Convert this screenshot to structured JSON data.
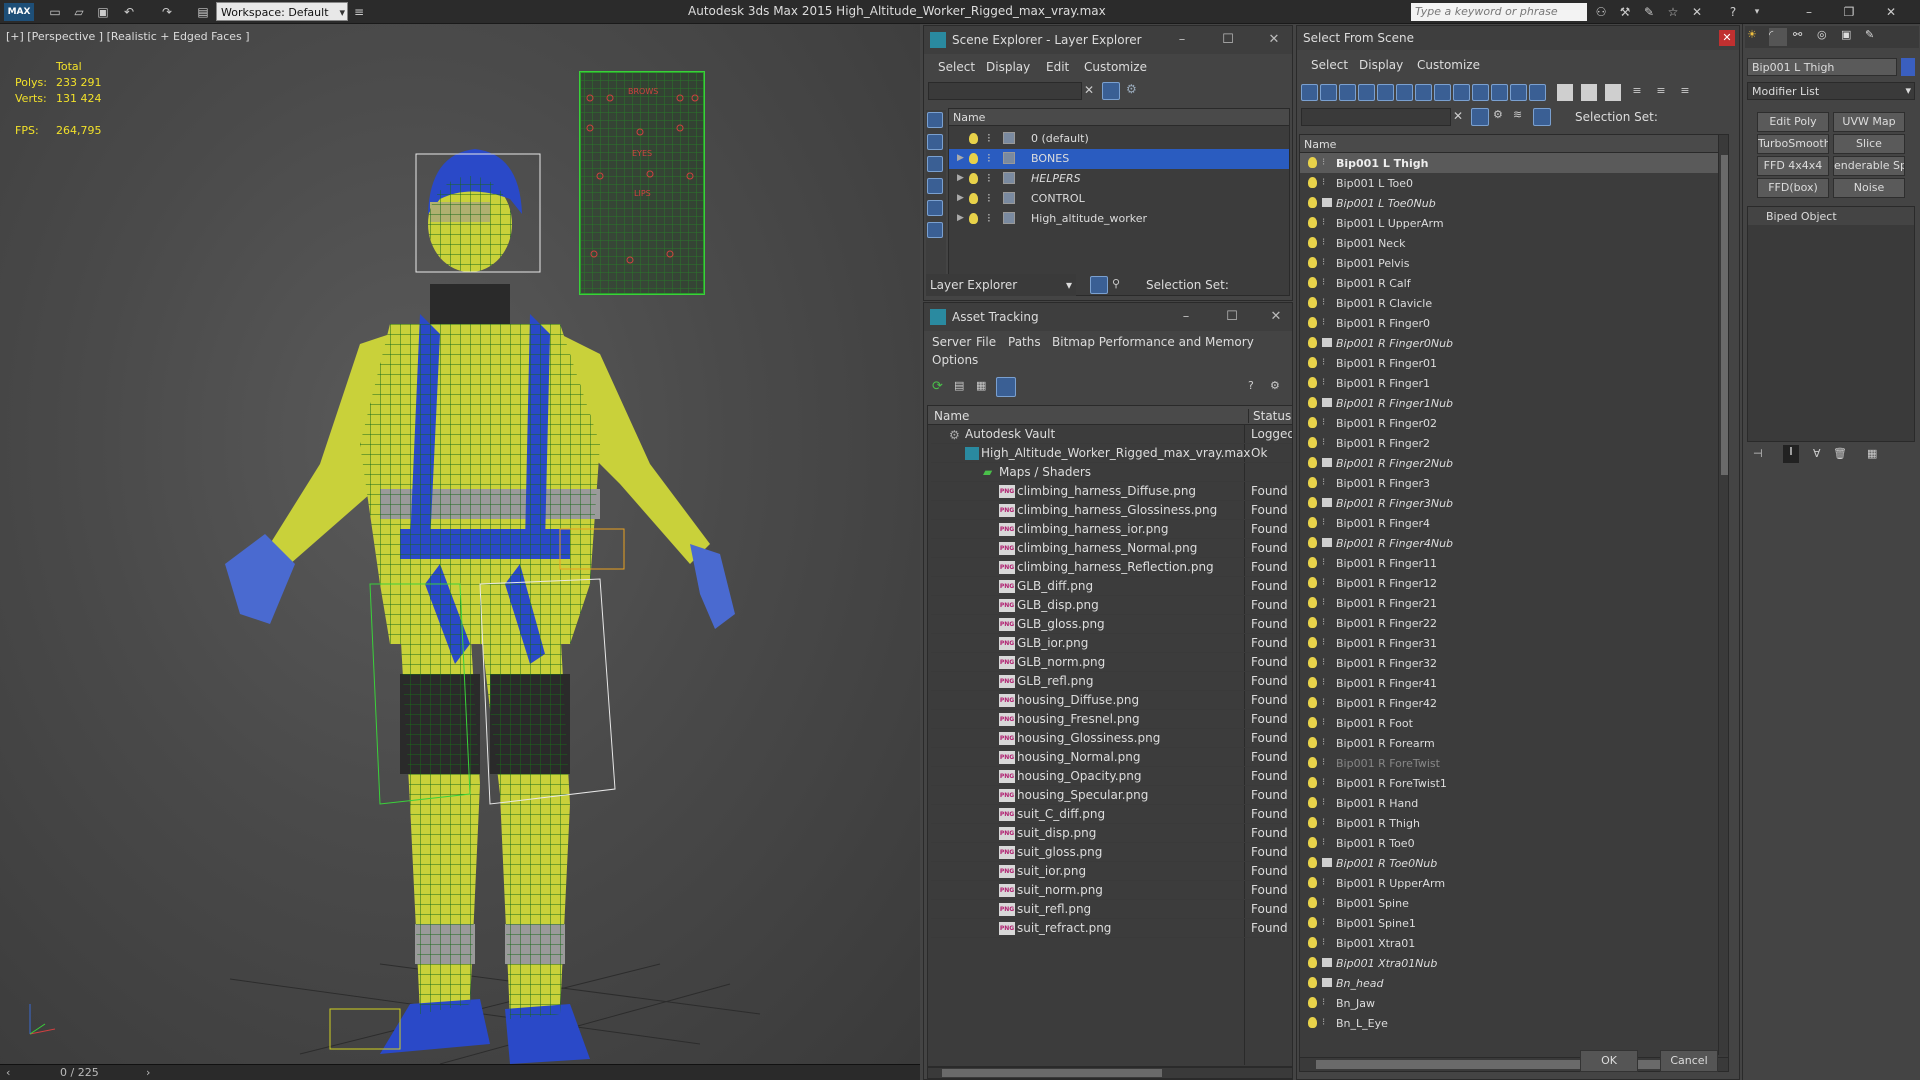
{
  "app": {
    "title": "Autodesk 3ds Max  2015     High_Altitude_Worker_Rigged_max_vray.max",
    "workspace": "Workspace: Default",
    "search_placeholder": "Type a keyword or phrase"
  },
  "viewport": {
    "label": "[+] [Perspective ] [Realistic + Edged Faces ]",
    "total_label": "Total",
    "polys_label": "Polys:",
    "polys_value": "233 291",
    "verts_label": "Verts:",
    "verts_value": "131 424",
    "fps_label": "FPS:",
    "fps_value": "264,795",
    "timeline": "0 / 225",
    "panel_labels": {
      "brows": "BROWS",
      "eyes": "EYES",
      "lips": "LIPS"
    }
  },
  "scene_explorer": {
    "title": "Scene Explorer - Layer Explorer",
    "menu": [
      "Select",
      "Display",
      "Edit",
      "Customize"
    ],
    "col_name": "Name",
    "layers": [
      {
        "name": "0 (default)",
        "selected": false,
        "italic": false,
        "expandable": false
      },
      {
        "name": "BONES",
        "selected": true,
        "italic": false,
        "expandable": true
      },
      {
        "name": "HELPERS",
        "selected": false,
        "italic": true,
        "expandable": true
      },
      {
        "name": "CONTROL",
        "selected": false,
        "italic": false,
        "expandable": true
      },
      {
        "name": "High_altitude_worker",
        "selected": false,
        "italic": false,
        "expandable": true
      }
    ],
    "footer_dropdown": "Layer Explorer",
    "selection_set_label": "Selection Set:"
  },
  "asset_tracking": {
    "title": "Asset Tracking",
    "menu": [
      "Server",
      "File",
      "Paths",
      "Bitmap Performance and Memory",
      "Options"
    ],
    "col_name": "Name",
    "col_status": "Status",
    "vault": {
      "name": "Autodesk Vault",
      "status": "Logged"
    },
    "file": {
      "name": "High_Altitude_Worker_Rigged_max_vray.max",
      "status": "Ok"
    },
    "group": "Maps / Shaders",
    "files": [
      "climbing_harness_Diffuse.png",
      "climbing_harness_Glossiness.png",
      "climbing_harness_ior.png",
      "climbing_harness_Normal.png",
      "climbing_harness_Reflection.png",
      "GLB_diff.png",
      "GLB_disp.png",
      "GLB_gloss.png",
      "GLB_ior.png",
      "GLB_norm.png",
      "GLB_refl.png",
      "housing_Diffuse.png",
      "housing_Fresnel.png",
      "housing_Glossiness.png",
      "housing_Normal.png",
      "housing_Opacity.png",
      "housing_Specular.png",
      "suit_C_diff.png",
      "suit_disp.png",
      "suit_gloss.png",
      "suit_ior.png",
      "suit_norm.png",
      "suit_refl.png",
      "suit_refract.png"
    ],
    "file_status": "Found",
    "png_badge": "PNG"
  },
  "select_from_scene": {
    "title": "Select From Scene",
    "menu": [
      "Select",
      "Display",
      "Customize"
    ],
    "selection_set_label": "Selection Set:",
    "col_name": "Name",
    "items": [
      {
        "name": "Bip001 L Thigh",
        "style": "selected"
      },
      {
        "name": "Bip001 L Toe0",
        "style": ""
      },
      {
        "name": "Bip001 L Toe0Nub",
        "style": "it"
      },
      {
        "name": "Bip001 L UpperArm",
        "style": ""
      },
      {
        "name": "Bip001 Neck",
        "style": ""
      },
      {
        "name": "Bip001 Pelvis",
        "style": ""
      },
      {
        "name": "Bip001 R Calf",
        "style": ""
      },
      {
        "name": "Bip001 R Clavicle",
        "style": ""
      },
      {
        "name": "Bip001 R Finger0",
        "style": ""
      },
      {
        "name": "Bip001 R Finger0Nub",
        "style": "it"
      },
      {
        "name": "Bip001 R Finger01",
        "style": ""
      },
      {
        "name": "Bip001 R Finger1",
        "style": ""
      },
      {
        "name": "Bip001 R Finger1Nub",
        "style": "it"
      },
      {
        "name": "Bip001 R Finger02",
        "style": ""
      },
      {
        "name": "Bip001 R Finger2",
        "style": ""
      },
      {
        "name": "Bip001 R Finger2Nub",
        "style": "it"
      },
      {
        "name": "Bip001 R Finger3",
        "style": ""
      },
      {
        "name": "Bip001 R Finger3Nub",
        "style": "it"
      },
      {
        "name": "Bip001 R Finger4",
        "style": ""
      },
      {
        "name": "Bip001 R Finger4Nub",
        "style": "it"
      },
      {
        "name": "Bip001 R Finger11",
        "style": ""
      },
      {
        "name": "Bip001 R Finger12",
        "style": ""
      },
      {
        "name": "Bip001 R Finger21",
        "style": ""
      },
      {
        "name": "Bip001 R Finger22",
        "style": ""
      },
      {
        "name": "Bip001 R Finger31",
        "style": ""
      },
      {
        "name": "Bip001 R Finger32",
        "style": ""
      },
      {
        "name": "Bip001 R Finger41",
        "style": ""
      },
      {
        "name": "Bip001 R Finger42",
        "style": ""
      },
      {
        "name": "Bip001 R Foot",
        "style": ""
      },
      {
        "name": "Bip001 R Forearm",
        "style": ""
      },
      {
        "name": "Bip001 R ForeTwist",
        "style": "dim"
      },
      {
        "name": "Bip001 R ForeTwist1",
        "style": ""
      },
      {
        "name": "Bip001 R Hand",
        "style": ""
      },
      {
        "name": "Bip001 R Thigh",
        "style": ""
      },
      {
        "name": "Bip001 R Toe0",
        "style": ""
      },
      {
        "name": "Bip001 R Toe0Nub",
        "style": "it"
      },
      {
        "name": "Bip001 R UpperArm",
        "style": ""
      },
      {
        "name": "Bip001 Spine",
        "style": ""
      },
      {
        "name": "Bip001 Spine1",
        "style": ""
      },
      {
        "name": "Bip001 Xtra01",
        "style": ""
      },
      {
        "name": "Bip001 Xtra01Nub",
        "style": "it"
      },
      {
        "name": "Bn_head",
        "style": "it"
      },
      {
        "name": "Bn_Jaw",
        "style": ""
      },
      {
        "name": "Bn_L_Eye",
        "style": ""
      }
    ],
    "ok": "OK",
    "cancel": "Cancel"
  },
  "modify_panel": {
    "object_name": "Bip001 L Thigh",
    "modifier_list": "Modifier List",
    "buttons": [
      "Edit Poly",
      "UVW Map",
      "TurboSmooth",
      "Slice",
      "FFD 4x4x4",
      "enderable Splin",
      "FFD(box)",
      "Noise"
    ],
    "stack_item": "Biped Object"
  },
  "colors": {
    "selection_blue": "#2a5cc0",
    "stat_yellow": "#f2e12a",
    "bulb_yellow": "#e8d24a",
    "mesh_green": "#3ad13a",
    "suit_yellow": "#d8e23a",
    "harness_blue": "#2a49c8"
  }
}
